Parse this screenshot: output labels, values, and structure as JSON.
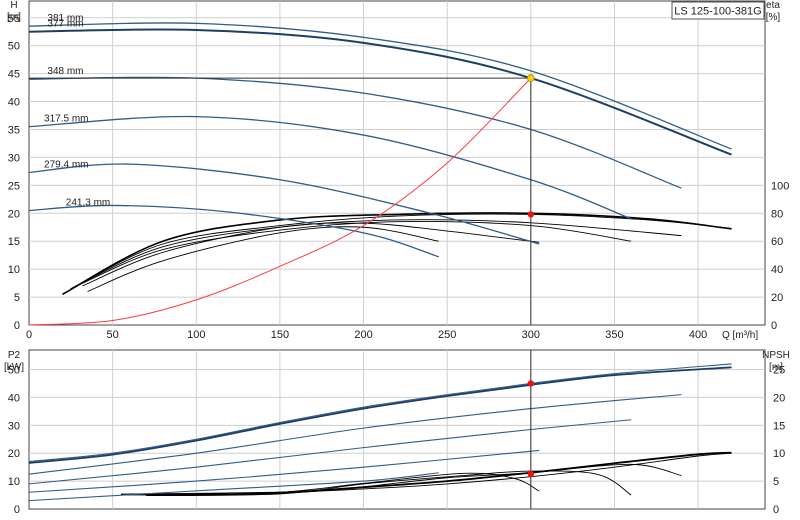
{
  "chart_data": [
    {
      "type": "line",
      "model": "LS 125-100-381G",
      "x_axis": {
        "label": "Q [m³/h]",
        "range": [
          0,
          440
        ],
        "ticks": [
          0,
          50,
          100,
          150,
          200,
          250,
          300,
          350,
          400
        ]
      },
      "y_left": {
        "name": "H",
        "unit": "[m]",
        "range": [
          0,
          58
        ],
        "ticks": [
          0,
          5,
          10,
          15,
          20,
          25,
          30,
          35,
          40,
          45,
          50,
          55
        ]
      },
      "y_right": {
        "name": "eta",
        "unit": "[%]",
        "range": [
          0,
          100
        ],
        "ticks": [
          0,
          20,
          40,
          60,
          80,
          100
        ]
      },
      "grid": true,
      "head_curves": [
        {
          "name": "381 mm",
          "points": [
            [
              0,
              53.5
            ],
            [
              100,
              54
            ],
            [
              200,
              51.5
            ],
            [
              300,
              45.5
            ],
            [
              420,
              31.5
            ]
          ]
        },
        {
          "name": "377 mm",
          "points": [
            [
              0,
              52.5
            ],
            [
              100,
              52.8
            ],
            [
              200,
              50.5
            ],
            [
              300,
              44.2
            ],
            [
              420,
              30.5
            ]
          ]
        },
        {
          "name": "348 mm",
          "points": [
            [
              0,
              44
            ],
            [
              100,
              44.2
            ],
            [
              200,
              41.5
            ],
            [
              300,
              35
            ],
            [
              390,
              24.5
            ]
          ]
        },
        {
          "name": "317.5 mm",
          "points": [
            [
              0,
              35.5
            ],
            [
              100,
              37.3
            ],
            [
              200,
              34
            ],
            [
              300,
              26
            ],
            [
              360,
              19
            ]
          ]
        },
        {
          "name": "279.4 mm",
          "points": [
            [
              0,
              27.3
            ],
            [
              60,
              28.8
            ],
            [
              150,
              26
            ],
            [
              240,
              20
            ],
            [
              305,
              14.5
            ]
          ]
        },
        {
          "name": "241.3 mm",
          "points": [
            [
              0,
              20.5
            ],
            [
              50,
              21.4
            ],
            [
              120,
              20.2
            ],
            [
              200,
              16.5
            ],
            [
              245,
              12.2
            ]
          ]
        }
      ],
      "efficiency_curves": [
        {
          "points": [
            [
              20,
              5.5
            ],
            [
              80,
              15
            ],
            [
              150,
              18.8
            ],
            [
              220,
              19.8
            ],
            [
              300,
              20
            ],
            [
              370,
              19
            ],
            [
              420,
              17.2
            ]
          ]
        },
        {
          "points": [
            [
              25,
              6.5
            ],
            [
              80,
              14.5
            ],
            [
              150,
              17.8
            ],
            [
              220,
              19.5
            ],
            [
              300,
              19.8
            ],
            [
              370,
              18.8
            ],
            [
              420,
              17.3
            ]
          ]
        },
        {
          "points": [
            [
              28,
              7
            ],
            [
              80,
              14
            ],
            [
              150,
              17.5
            ],
            [
              220,
              18.8
            ],
            [
              300,
              18.3
            ],
            [
              390,
              16
            ]
          ]
        },
        {
          "points": [
            [
              30,
              7.2
            ],
            [
              80,
              13.5
            ],
            [
              150,
              17
            ],
            [
              220,
              18.5
            ],
            [
              300,
              17.8
            ],
            [
              360,
              15
            ]
          ]
        },
        {
          "points": [
            [
              32,
              7
            ],
            [
              80,
              13
            ],
            [
              150,
              17.5
            ],
            [
              200,
              18.2
            ],
            [
              245,
              17
            ],
            [
              305,
              14.8
            ]
          ]
        },
        {
          "points": [
            [
              35,
              6
            ],
            [
              80,
              11.5
            ],
            [
              150,
              16.5
            ],
            [
              200,
              17.5
            ],
            [
              245,
              15
            ]
          ]
        }
      ],
      "system_curve": [
        [
          0,
          0
        ],
        [
          50,
          0.8
        ],
        [
          100,
          4.5
        ],
        [
          150,
          10.5
        ],
        [
          200,
          17.8
        ],
        [
          250,
          29
        ],
        [
          300,
          44.2
        ]
      ],
      "operating_point": {
        "Q": 300,
        "H": 44.2,
        "eta_H": 19.8
      },
      "curve_labels": [
        "381 mm",
        "377 mm",
        "348 mm",
        "317.5 mm",
        "279.4 mm",
        "241.3 mm"
      ]
    },
    {
      "type": "line",
      "x_axis": {
        "range": [
          0,
          440
        ]
      },
      "y_left": {
        "name": "P2",
        "unit": "[kW]",
        "range": [
          0,
          57
        ],
        "ticks": [
          0,
          10,
          20,
          30,
          40,
          50
        ]
      },
      "y_right": {
        "name": "NPSH",
        "unit": "[m]",
        "range": [
          0,
          28.5
        ],
        "ticks": [
          0,
          5,
          10,
          15,
          20,
          25
        ]
      },
      "grid": true,
      "power_curves": [
        {
          "points": [
            [
              0,
              17
            ],
            [
              50,
              20
            ],
            [
              100,
              25
            ],
            [
              150,
              31
            ],
            [
              200,
              36.5
            ],
            [
              250,
              41
            ],
            [
              300,
              45
            ],
            [
              350,
              48.5
            ],
            [
              420,
              52
            ]
          ]
        },
        {
          "points": [
            [
              0,
              16.5
            ],
            [
              50,
              19.5
            ],
            [
              100,
              24.5
            ],
            [
              150,
              30.5
            ],
            [
              200,
              36
            ],
            [
              250,
              40.5
            ],
            [
              300,
              44.5
            ],
            [
              350,
              48
            ],
            [
              420,
              50.8
            ]
          ]
        },
        {
          "points": [
            [
              0,
              12.5
            ],
            [
              100,
              20
            ],
            [
              200,
              29
            ],
            [
              300,
              36
            ],
            [
              390,
              41
            ]
          ]
        },
        {
          "points": [
            [
              0,
              9
            ],
            [
              100,
              15
            ],
            [
              200,
              22
            ],
            [
              300,
              28.5
            ],
            [
              360,
              32
            ]
          ]
        },
        {
          "points": [
            [
              0,
              6
            ],
            [
              100,
              10
            ],
            [
              200,
              15
            ],
            [
              305,
              21
            ]
          ]
        },
        {
          "points": [
            [
              0,
              3
            ],
            [
              100,
              6.5
            ],
            [
              200,
              10
            ],
            [
              245,
              13
            ]
          ]
        }
      ],
      "npsh_curves": [
        {
          "points": [
            [
              55,
              2.6
            ],
            [
              100,
              2.6
            ],
            [
              150,
              2.9
            ],
            [
              200,
              3.9
            ],
            [
              250,
              5
            ],
            [
              300,
              6.5
            ],
            [
              350,
              8.2
            ],
            [
              400,
              9.8
            ],
            [
              420,
              10.1
            ]
          ]
        },
        {
          "points": [
            [
              60,
              2.7
            ],
            [
              150,
              3
            ],
            [
              200,
              3.6
            ],
            [
              250,
              4.5
            ],
            [
              300,
              5.8
            ],
            [
              350,
              7.5
            ],
            [
              400,
              9.5
            ],
            [
              420,
              10
            ]
          ]
        },
        {
          "points": [
            [
              70,
              2.5
            ],
            [
              150,
              2.8
            ],
            [
              200,
              4
            ],
            [
              250,
              5.6
            ],
            [
              300,
              6.5
            ],
            [
              360,
              8
            ],
            [
              390,
              6
            ]
          ]
        },
        {
          "points": [
            [
              70,
              2.4
            ],
            [
              150,
              2.7
            ],
            [
              200,
              4.5
            ],
            [
              260,
              6
            ],
            [
              300,
              6.8
            ],
            [
              340,
              6.2
            ],
            [
              360,
              2.5
            ]
          ]
        },
        {
          "points": [
            [
              80,
              2.5
            ],
            [
              150,
              3
            ],
            [
              200,
              4.6
            ],
            [
              260,
              6.4
            ],
            [
              290,
              5.5
            ],
            [
              305,
              3.2
            ]
          ]
        }
      ],
      "operating_points": {
        "Q": 300,
        "P2": 45,
        "NPSH": 6.3
      }
    }
  ],
  "labels": {
    "title": "LS 125-100-381G",
    "top_y_left_name": "H",
    "top_y_left_unit": "[m]",
    "top_y_right_name": "eta",
    "top_y_right_unit": "[%]",
    "x_label": "Q [m³/h]",
    "bottom_y_left_name": "P2",
    "bottom_y_left_unit": "[kW]",
    "bottom_y_right_name": "NPSH",
    "bottom_y_right_unit": "[m]"
  },
  "colors": {
    "head": "#2f5d8a",
    "head_bold": "#1c3f66",
    "eff": "#000000",
    "system": "#ff3b3b",
    "op_marker_yellow": "#ffcc00",
    "op_marker_red": "#ee1111",
    "grid": "#cfcfcf"
  }
}
